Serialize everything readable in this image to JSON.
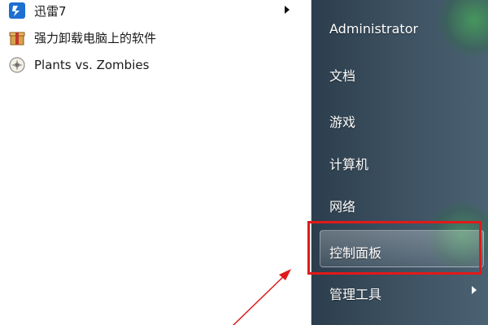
{
  "programs": [
    {
      "label": "迅雷7",
      "icon": "xunlei-icon",
      "has_submenu": true
    },
    {
      "label": "强力卸载电脑上的软件",
      "icon": "uninstaller-icon",
      "has_submenu": false
    },
    {
      "label": "Plants vs. Zombies",
      "icon": "plants-vs-zombies-icon",
      "has_submenu": false
    }
  ],
  "right_menu": {
    "user": "Administrator",
    "items": [
      {
        "label": "文档"
      },
      {
        "label": "游戏"
      },
      {
        "label": "计算机"
      },
      {
        "label": "网络"
      },
      {
        "label": "控制面板",
        "highlighted": true
      },
      {
        "label": "管理工具",
        "has_submenu": true
      }
    ]
  },
  "colors": {
    "annotation": "#e01a1a",
    "panel_dark": "#2c3e4d"
  }
}
